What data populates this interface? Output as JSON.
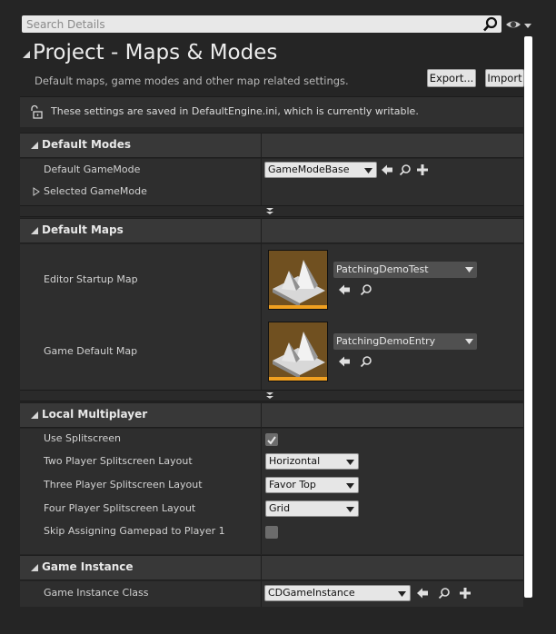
{
  "search": {
    "placeholder": "Search Details"
  },
  "header": {
    "title": "Project - Maps & Modes",
    "description": "Default maps, game modes and other map related settings.",
    "export_label": "Export...",
    "import_label": "Import"
  },
  "notice": {
    "text": "These settings are saved in DefaultEngine.ini, which is currently writable."
  },
  "default_modes": {
    "title": "Default Modes",
    "gamemode_label": "Default GameMode",
    "gamemode_value": "GameModeBase",
    "selected_gamemode_label": "Selected GameMode"
  },
  "default_maps": {
    "title": "Default Maps",
    "editor_startup_label": "Editor Startup Map",
    "editor_startup_value": "PatchingDemoTest",
    "game_default_label": "Game Default Map",
    "game_default_value": "PatchingDemoEntry"
  },
  "local_multiplayer": {
    "title": "Local Multiplayer",
    "use_splitscreen_label": "Use Splitscreen",
    "use_splitscreen_checked": true,
    "two_player_label": "Two Player Splitscreen Layout",
    "two_player_value": "Horizontal",
    "three_player_label": "Three Player Splitscreen Layout",
    "three_player_value": "Favor Top",
    "four_player_label": "Four Player Splitscreen Layout",
    "four_player_value": "Grid",
    "skip_gamepad_label": "Skip Assigning Gamepad to Player 1",
    "skip_gamepad_checked": false
  },
  "game_instance": {
    "title": "Game Instance",
    "class_label": "Game Instance Class",
    "class_value": "CDGameInstance"
  },
  "colors": {
    "background": "#252525",
    "category": "#383838",
    "row": "#2e2e2e",
    "thumbnail_accent": "#f0a020"
  }
}
